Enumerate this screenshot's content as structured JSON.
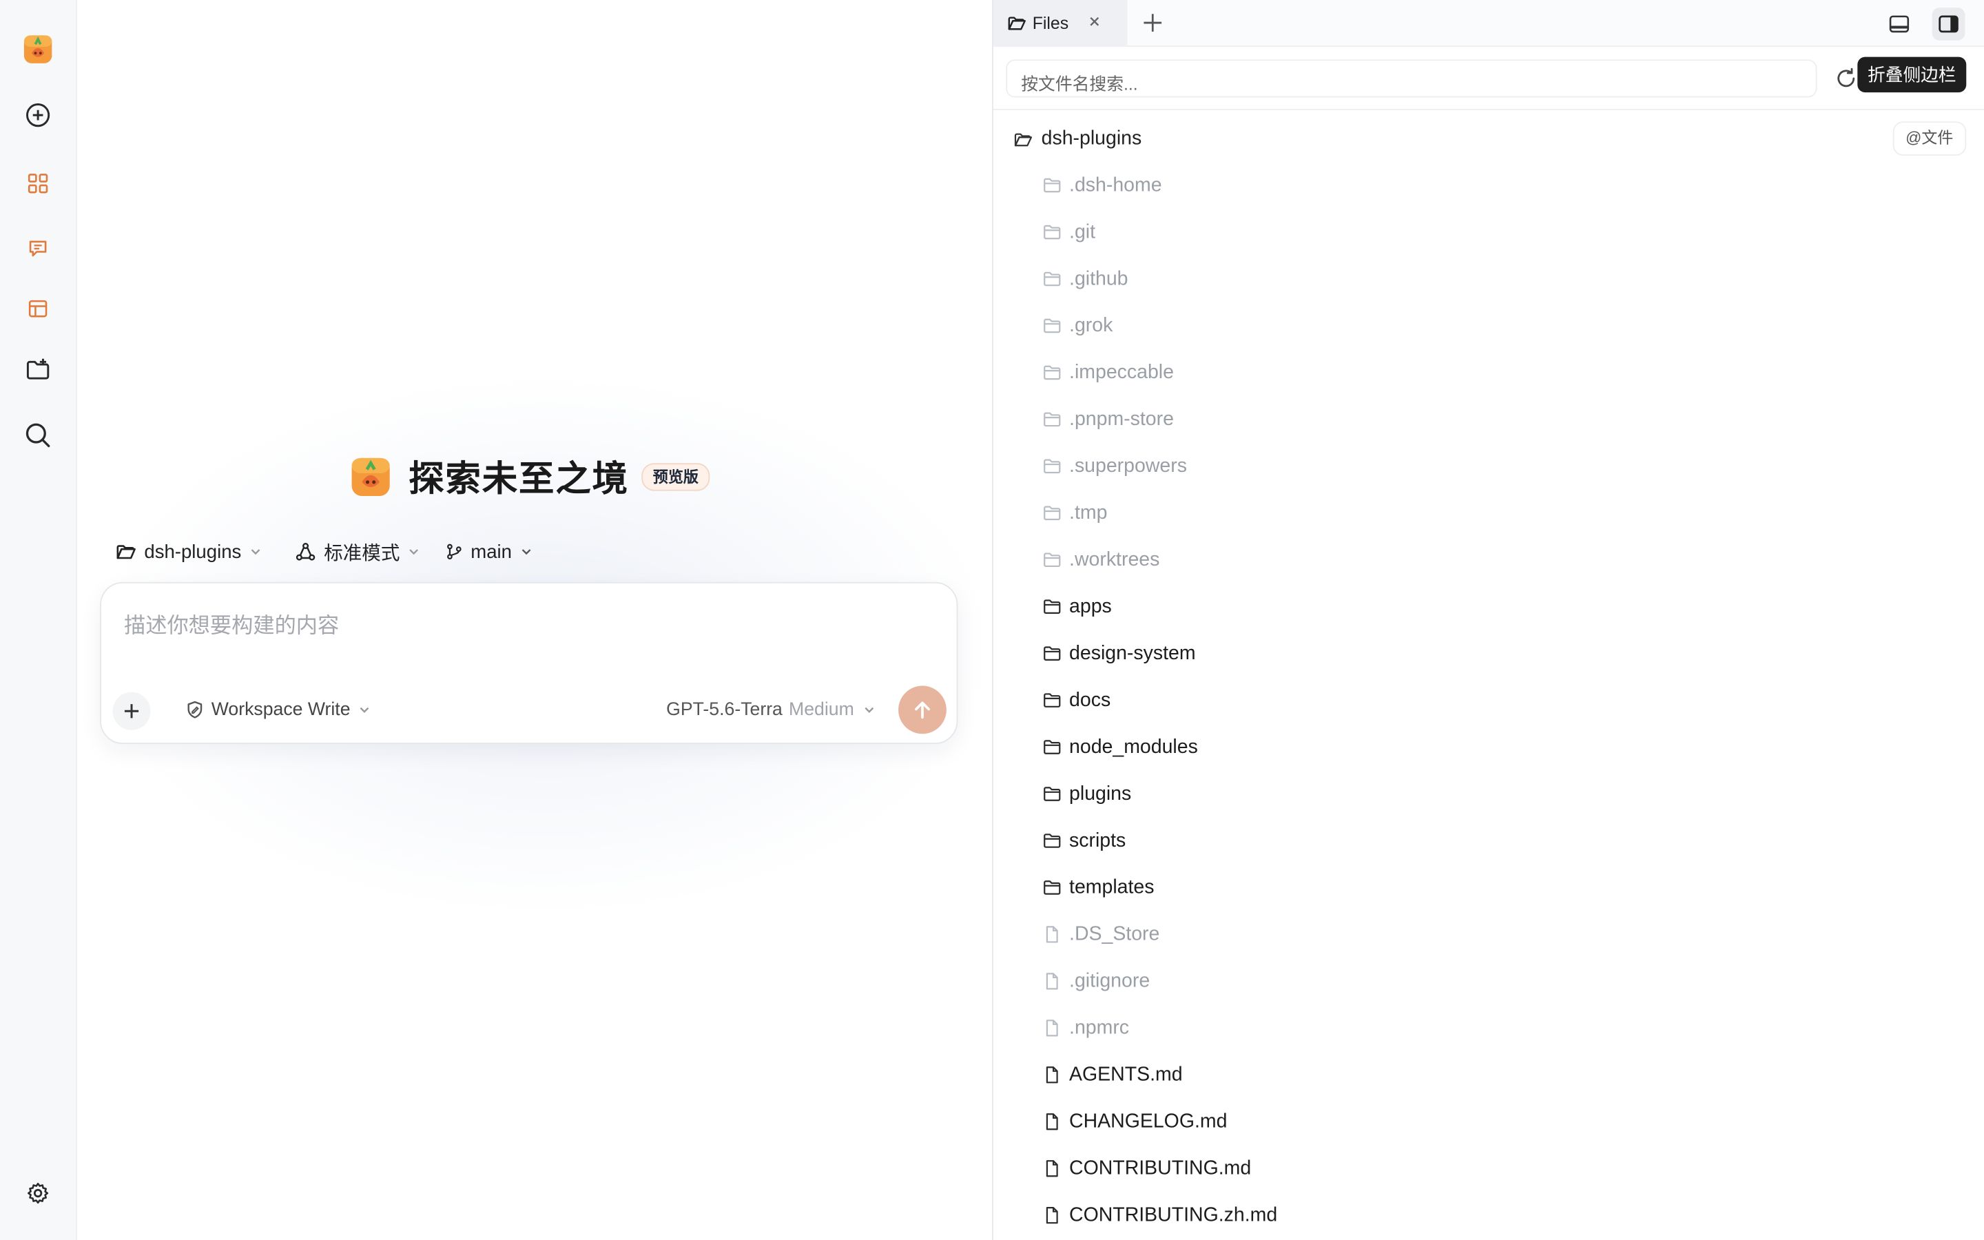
{
  "app": {
    "icon": "carrot-app-logo"
  },
  "rail": {
    "items": [
      {
        "name": "new-chat",
        "icon": "plus-circle-icon"
      },
      {
        "name": "apps",
        "icon": "grid-icon"
      },
      {
        "name": "messages",
        "icon": "chat-bubble-icon"
      },
      {
        "name": "layout",
        "icon": "table-layout-icon"
      },
      {
        "name": "add-folder",
        "icon": "folder-add-icon"
      },
      {
        "name": "search",
        "icon": "search-icon"
      }
    ],
    "settings_icon": "gear-icon"
  },
  "hero": {
    "title": "探索未至之境",
    "badge": "预览版"
  },
  "context": {
    "project": "dsh-plugins",
    "mode": "标准模式",
    "branch": "main"
  },
  "prompt": {
    "placeholder": "描述你想要构建的内容",
    "permission": "Workspace Write",
    "model": "GPT-5.6-Terra",
    "model_level": "Medium"
  },
  "panel": {
    "tab_label": "Files",
    "tooltip": "折叠侧边栏",
    "search_placeholder": "按文件名搜索...",
    "root": "dsh-plugins",
    "mention_button": "@文件",
    "entries": [
      {
        "name": ".dsh-home",
        "type": "folder",
        "dim": true
      },
      {
        "name": ".git",
        "type": "folder",
        "dim": true
      },
      {
        "name": ".github",
        "type": "folder",
        "dim": true
      },
      {
        "name": ".grok",
        "type": "folder",
        "dim": true
      },
      {
        "name": ".impeccable",
        "type": "folder",
        "dim": true
      },
      {
        "name": ".pnpm-store",
        "type": "folder",
        "dim": true
      },
      {
        "name": ".superpowers",
        "type": "folder",
        "dim": true
      },
      {
        "name": ".tmp",
        "type": "folder",
        "dim": true
      },
      {
        "name": ".worktrees",
        "type": "folder",
        "dim": true
      },
      {
        "name": "apps",
        "type": "folder",
        "dim": false
      },
      {
        "name": "design-system",
        "type": "folder",
        "dim": false
      },
      {
        "name": "docs",
        "type": "folder",
        "dim": false
      },
      {
        "name": "node_modules",
        "type": "folder",
        "dim": false
      },
      {
        "name": "plugins",
        "type": "folder",
        "dim": false
      },
      {
        "name": "scripts",
        "type": "folder",
        "dim": false
      },
      {
        "name": "templates",
        "type": "folder",
        "dim": false
      },
      {
        "name": ".DS_Store",
        "type": "file",
        "dim": true
      },
      {
        "name": ".gitignore",
        "type": "file",
        "dim": true
      },
      {
        "name": ".npmrc",
        "type": "file",
        "dim": true
      },
      {
        "name": "AGENTS.md",
        "type": "file",
        "dim": false
      },
      {
        "name": "CHANGELOG.md",
        "type": "file",
        "dim": false
      },
      {
        "name": "CONTRIBUTING.md",
        "type": "file",
        "dim": false
      },
      {
        "name": "CONTRIBUTING.zh.md",
        "type": "file",
        "dim": false
      }
    ]
  },
  "colors": {
    "accent": "#e07a3c",
    "send_button": "#e7b59e",
    "badge_bg": "#fdf1ea"
  }
}
